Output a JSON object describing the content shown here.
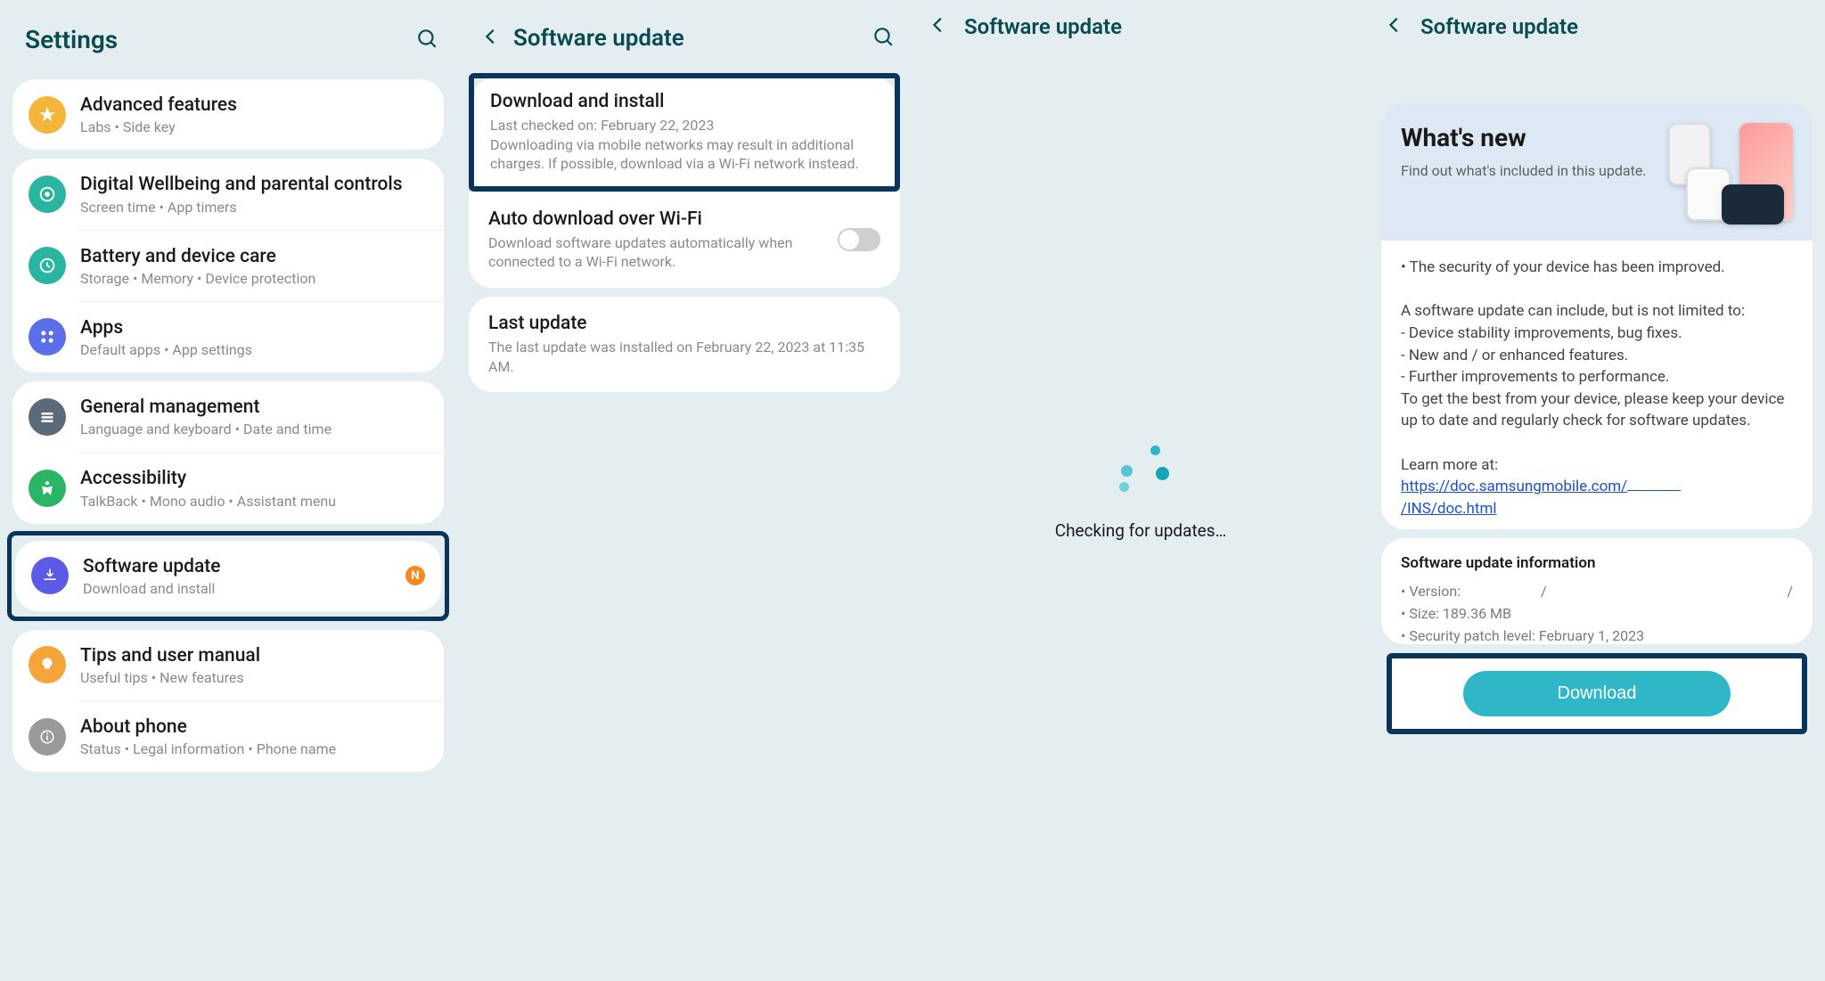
{
  "panel1": {
    "title": "Settings",
    "groups": [
      {
        "items": [
          {
            "title": "Advanced features",
            "sub": "Labs  •  Side key",
            "icon": "star",
            "bg": "#f5b53a"
          }
        ]
      },
      {
        "items": [
          {
            "title": "Digital Wellbeing and parental controls",
            "sub": "Screen time  •  App timers",
            "icon": "wellbeing",
            "bg": "#2ab5a0"
          },
          {
            "title": "Battery and device care",
            "sub": "Storage  •  Memory  •  Device protection",
            "icon": "care",
            "bg": "#2ab5a0"
          },
          {
            "title": "Apps",
            "sub": "Default apps  •  App settings",
            "icon": "apps",
            "bg": "#5b6fe8"
          }
        ]
      },
      {
        "items": [
          {
            "title": "General management",
            "sub": "Language and keyboard  •  Date and time",
            "icon": "general",
            "bg": "#5a6a7a"
          },
          {
            "title": "Accessibility",
            "sub": "TalkBack  •  Mono audio  •  Assistant menu",
            "icon": "a11y",
            "bg": "#2ab566"
          }
        ]
      },
      {
        "highlighted": true,
        "items": [
          {
            "title": "Software update",
            "sub": "Download and install",
            "icon": "update",
            "bg": "#5b5be8",
            "badge": "N"
          }
        ]
      },
      {
        "items": [
          {
            "title": "Tips and user manual",
            "sub": "Useful tips  •  New features",
            "icon": "tips",
            "bg": "#f5a53a"
          },
          {
            "title": "About phone",
            "sub": "Status  •  Legal information  •  Phone name",
            "icon": "about",
            "bg": "#8a8a8a"
          }
        ]
      }
    ]
  },
  "panel2": {
    "title": "Software update",
    "download": {
      "title": "Download and install",
      "sub": "Last checked on: February 22, 2023\nDownloading via mobile networks may result in additional charges. If possible, download via a Wi-Fi network instead."
    },
    "auto": {
      "title": "Auto download over Wi-Fi",
      "sub": "Download software updates automatically when connected to a Wi-Fi network.",
      "enabled": false
    },
    "last": {
      "title": "Last update",
      "sub": "The last update was installed on February 22, 2023 at 11:35 AM."
    }
  },
  "panel3": {
    "title": "Software update",
    "checking": "Checking for updates…"
  },
  "panel4": {
    "title": "Software update",
    "hero_title": "What's new",
    "hero_sub": "Find out what's included in this update.",
    "body_intro": "• The security of your device has been improved.",
    "body_inc": "A software update can include, but is not limited to:",
    "body_b1": " - Device stability improvements, bug fixes.",
    "body_b2": " - New and / or enhanced features.",
    "body_b3": " - Further improvements to performance.",
    "body_best": "To get the best from your device, please keep your device up to date and regularly check for software updates.",
    "learn": "Learn more at:",
    "link1": "https://doc.samsungmobile.com/",
    "link2": "/INS/doc.html",
    "info_title": "Software update information",
    "version_label": "• Version:",
    "size": "• Size: 189.36 MB",
    "patch": "• Security patch level: February 1, 2023",
    "download": "Download"
  }
}
